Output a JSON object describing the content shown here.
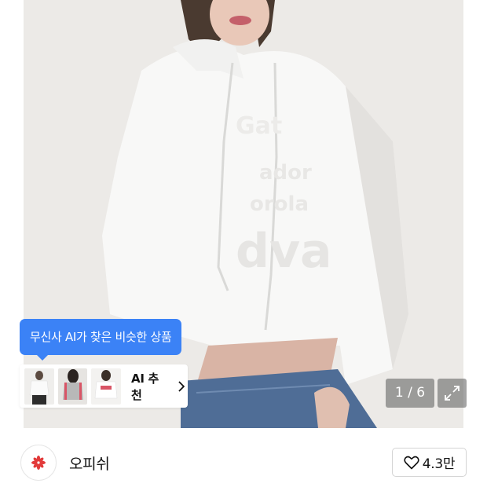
{
  "recommendation": {
    "tooltip_text": "무신사 AI가 찾은 비슷한 상품",
    "card_label": "AI 추천",
    "thumbnails": [
      "product-thumbnail",
      "product-thumbnail",
      "product-thumbnail"
    ]
  },
  "gallery": {
    "counter": "1 / 6"
  },
  "shop": {
    "name": "오피쉬",
    "like_count": "4.3만"
  },
  "colors": {
    "accent_blue": "#3b82f6",
    "logo_red": "#e23b3b"
  }
}
